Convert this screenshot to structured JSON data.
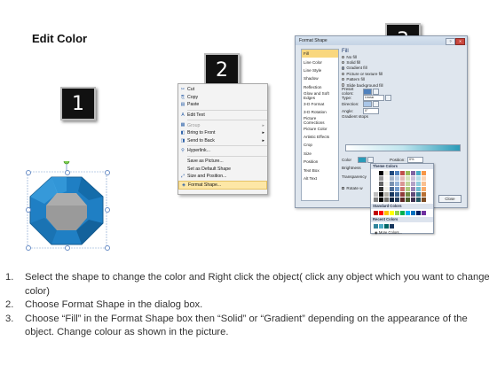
{
  "title": "Edit Color",
  "steps": [
    "1",
    "2",
    "3"
  ],
  "context_menu": {
    "items": [
      {
        "label": "Cut",
        "icon": "scissors-icon",
        "glyph": "✂"
      },
      {
        "label": "Copy",
        "icon": "copy-icon",
        "glyph": "⎘"
      },
      {
        "label": "Paste",
        "icon": "paste-icon",
        "glyph": "▤"
      },
      {
        "label": "Edit Text",
        "icon": "edit-text-icon",
        "glyph": "A"
      },
      {
        "label": "Group",
        "icon": "group-icon",
        "glyph": "▦",
        "disabled": true,
        "submenu": true
      },
      {
        "label": "Bring to Front",
        "icon": "bring-to-front-icon",
        "glyph": "◧",
        "submenu": true
      },
      {
        "label": "Send to Back",
        "icon": "send-to-back-icon",
        "glyph": "◨",
        "submenu": true
      },
      {
        "label": "Hyperlink...",
        "icon": "hyperlink-icon",
        "glyph": "⚲"
      },
      {
        "label": "Save as Picture...",
        "icon": "save-picture-icon",
        "glyph": ""
      },
      {
        "label": "Set as Default Shape",
        "icon": "default-shape-icon",
        "glyph": ""
      },
      {
        "label": "Size and Position...",
        "icon": "size-position-icon",
        "glyph": "⤢"
      },
      {
        "label": "Format Shape...",
        "icon": "format-shape-icon",
        "glyph": "◈",
        "highlighted": true
      }
    ]
  },
  "dialog": {
    "title": "Format Shape",
    "nav": [
      "Fill",
      "Line Color",
      "Line Style",
      "Shadow",
      "Reflection",
      "Glow and Soft Edges",
      "3-D Format",
      "3-D Rotation",
      "Picture Corrections",
      "Picture Color",
      "Artistic Effects",
      "Crop",
      "Size",
      "Position",
      "Text Box",
      "Alt Text"
    ],
    "selected_nav": "Fill",
    "section_title": "Fill",
    "fill_options": [
      "No fill",
      "Solid fill",
      "Gradient fill",
      "Picture or texture fill",
      "Pattern fill",
      "Slide background fill"
    ],
    "selected_fill": "Gradient fill",
    "preset_colors_label": "Preset colors:",
    "type_label": "Type:",
    "type_value": "Linear",
    "direction_label": "Direction:",
    "angle_label": "Angle:",
    "angle_value": "0°",
    "gradient_stops_label": "Gradient stops",
    "color_label": "Color",
    "position_label": "Position:",
    "position_value": "0%",
    "brightness_label": "Brightness",
    "transparency_label": "Transparency",
    "rotate_label": "Rotate w",
    "close_label": "Close"
  },
  "palette": {
    "theme_title": "Theme Colors",
    "standard_title": "Standard Colors",
    "recent_title": "Recent Colors",
    "more_colors": "More Colors...",
    "theme_row": [
      "#ffffff",
      "#000000",
      "#eeece1",
      "#1f497d",
      "#4f81bd",
      "#c0504d",
      "#9bbb59",
      "#8064a2",
      "#4bacc6",
      "#f79646"
    ],
    "standard_row": [
      "#c00000",
      "#ff0000",
      "#ffc000",
      "#ffff00",
      "#92d050",
      "#00b050",
      "#00b0f0",
      "#0070c0",
      "#002060",
      "#7030a0"
    ],
    "recent_row": [
      "#31859c",
      "#4bacc6",
      "#006666",
      "#17375e"
    ]
  },
  "instructions": [
    {
      "num": "1.",
      "text": "Select the shape to change the color and Right click the object( click any object which you want to change color)"
    },
    {
      "num": "2.",
      "text": "Choose Format Shape in the dialog box."
    },
    {
      "num": "3.",
      "text": "Choose “Fill” in the Format Shape box then “Solid” or “Gradient” depending on the appearance of the object. Change colour as shown in the picture."
    }
  ],
  "colors": {
    "shape_blue": "#1f7fc4",
    "shape_center": "#9a9a9a",
    "highlight": "#fde7a6"
  }
}
